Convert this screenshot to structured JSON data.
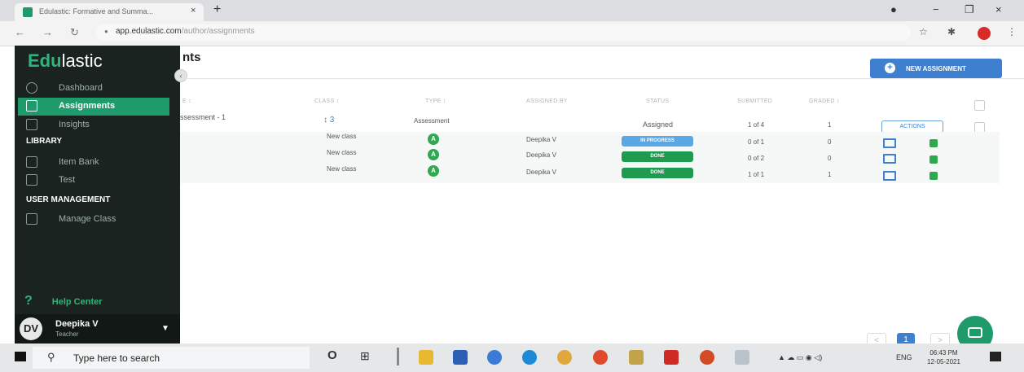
{
  "browser": {
    "tab_title": "Edulastic: Formative and Summa...",
    "tab_close": "×",
    "new_tab": "+",
    "url_host": "app.edulastic.com",
    "url_path": "/author/assignments",
    "icons": [
      "back-icon",
      "forward-icon",
      "reload-icon",
      "lock-icon",
      "star-icon",
      "extension-icon"
    ]
  },
  "sidebar": {
    "logo_accent": "Edu",
    "logo_rest": "lastic",
    "items": [
      {
        "label": "Dashboard",
        "icon": "dashboard-icon"
      },
      {
        "label": "Assignments",
        "icon": "assignments-icon",
        "active": true
      },
      {
        "label": "Insights",
        "icon": "insights-icon"
      }
    ],
    "library_header": "LIBRARY",
    "library_items": [
      {
        "label": "Item Bank",
        "icon": "item-bank-icon"
      },
      {
        "label": "Test",
        "icon": "test-icon"
      }
    ],
    "user_mgmt_header": "USER MANAGEMENT",
    "user_mgmt_items": [
      {
        "label": "Manage Class",
        "icon": "manage-class-icon"
      }
    ],
    "help": "Help Center",
    "user": {
      "initials": "DV",
      "name": "Deepika V",
      "role": "Teacher"
    }
  },
  "main": {
    "title": "nts",
    "new_assignment": "NEW ASSIGNMENT",
    "columns": {
      "name": "E ↕",
      "class": "CLASS ↕",
      "type": "TYPE ↕",
      "assigned_by": "ASSIGNED BY",
      "status": "STATUS",
      "submitted": "SUBMITTED",
      "graded": "GRADED ↕"
    },
    "summary_row": {
      "name": "ssessment - 1",
      "class": "↕ 3",
      "type": "Assessment",
      "status": "Assigned",
      "submitted": "1 of 4",
      "graded": "1",
      "actions": "ACTIONS"
    },
    "rows": [
      {
        "class": "New class",
        "type_badge": "A",
        "assigned_by": "Deepika V",
        "status": "IN PROGRESS",
        "status_color": "#5aa7e6",
        "submitted": "0 of 1",
        "graded": "0"
      },
      {
        "class": "New class",
        "type_badge": "A",
        "assigned_by": "Deepika V",
        "status": "DONE",
        "status_color": "#1e9b4f",
        "submitted": "0 of 2",
        "graded": "0"
      },
      {
        "class": "New class",
        "type_badge": "A",
        "assigned_by": "Deepika V",
        "status": "DONE",
        "status_color": "#1e9b4f",
        "submitted": "1 of 1",
        "graded": "1"
      }
    ],
    "pagination": {
      "prev": "<",
      "current": "1",
      "next": ">"
    }
  },
  "taskbar": {
    "search_placeholder": "Type here to search",
    "tray_lang": "ENG",
    "time": "06:43 PM",
    "date": "12-05-2021"
  },
  "colors": {
    "accent_green": "#1f9a6a",
    "accent_blue": "#3e7fcf",
    "sidebar_bg": "#1b2320"
  }
}
